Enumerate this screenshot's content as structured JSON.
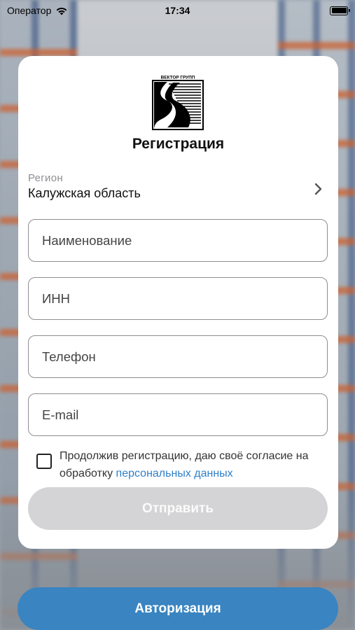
{
  "status_bar": {
    "carrier": "Оператор",
    "time": "17:34",
    "wifi_icon": "wifi-icon",
    "battery_icon": "battery-icon"
  },
  "logo": {
    "text": "ВЕКТОР ГРУПП",
    "icon": "vector-group-logo"
  },
  "form": {
    "title": "Регистрация",
    "region": {
      "label": "Регион",
      "value": "Калужская область",
      "icon": "chevron-right-icon"
    },
    "fields": {
      "name_placeholder": "Наименование",
      "inn_placeholder": "ИНН",
      "phone_placeholder": "Телефон",
      "email_placeholder": "E-mail"
    },
    "consent": {
      "text": "Продолжив регистрацию, даю своё согласие на обработку",
      "link": "персональных данных",
      "checked": false
    },
    "submit_label": "Отправить"
  },
  "auth_button_label": "Авторизация",
  "colors": {
    "accent": "#3984c1",
    "link": "#2f80c9",
    "disabled_button": "#d4d4d6",
    "card_background": "#ffffff"
  }
}
